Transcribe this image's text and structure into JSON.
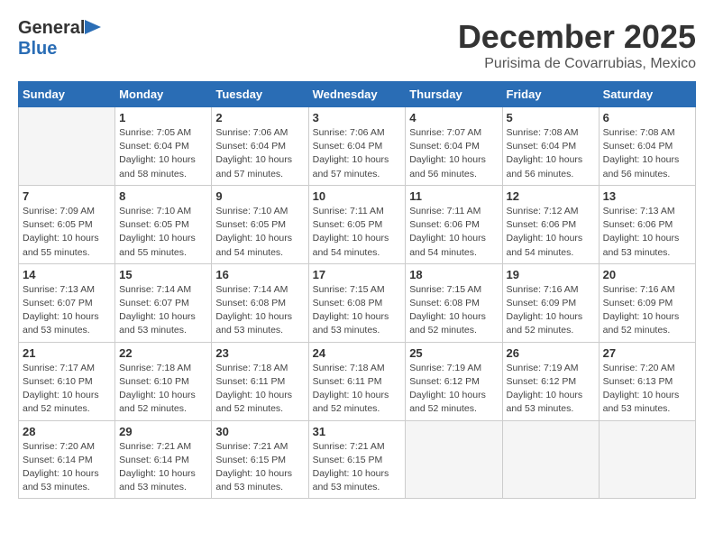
{
  "header": {
    "logo_general": "General",
    "logo_blue": "Blue",
    "month_title": "December 2025",
    "subtitle": "Purisima de Covarrubias, Mexico"
  },
  "days_of_week": [
    "Sunday",
    "Monday",
    "Tuesday",
    "Wednesday",
    "Thursday",
    "Friday",
    "Saturday"
  ],
  "weeks": [
    [
      {
        "day": "",
        "info": ""
      },
      {
        "day": "1",
        "info": "Sunrise: 7:05 AM\nSunset: 6:04 PM\nDaylight: 10 hours\nand 58 minutes."
      },
      {
        "day": "2",
        "info": "Sunrise: 7:06 AM\nSunset: 6:04 PM\nDaylight: 10 hours\nand 57 minutes."
      },
      {
        "day": "3",
        "info": "Sunrise: 7:06 AM\nSunset: 6:04 PM\nDaylight: 10 hours\nand 57 minutes."
      },
      {
        "day": "4",
        "info": "Sunrise: 7:07 AM\nSunset: 6:04 PM\nDaylight: 10 hours\nand 56 minutes."
      },
      {
        "day": "5",
        "info": "Sunrise: 7:08 AM\nSunset: 6:04 PM\nDaylight: 10 hours\nand 56 minutes."
      },
      {
        "day": "6",
        "info": "Sunrise: 7:08 AM\nSunset: 6:04 PM\nDaylight: 10 hours\nand 56 minutes."
      }
    ],
    [
      {
        "day": "7",
        "info": "Sunrise: 7:09 AM\nSunset: 6:05 PM\nDaylight: 10 hours\nand 55 minutes."
      },
      {
        "day": "8",
        "info": "Sunrise: 7:10 AM\nSunset: 6:05 PM\nDaylight: 10 hours\nand 55 minutes."
      },
      {
        "day": "9",
        "info": "Sunrise: 7:10 AM\nSunset: 6:05 PM\nDaylight: 10 hours\nand 54 minutes."
      },
      {
        "day": "10",
        "info": "Sunrise: 7:11 AM\nSunset: 6:05 PM\nDaylight: 10 hours\nand 54 minutes."
      },
      {
        "day": "11",
        "info": "Sunrise: 7:11 AM\nSunset: 6:06 PM\nDaylight: 10 hours\nand 54 minutes."
      },
      {
        "day": "12",
        "info": "Sunrise: 7:12 AM\nSunset: 6:06 PM\nDaylight: 10 hours\nand 54 minutes."
      },
      {
        "day": "13",
        "info": "Sunrise: 7:13 AM\nSunset: 6:06 PM\nDaylight: 10 hours\nand 53 minutes."
      }
    ],
    [
      {
        "day": "14",
        "info": "Sunrise: 7:13 AM\nSunset: 6:07 PM\nDaylight: 10 hours\nand 53 minutes."
      },
      {
        "day": "15",
        "info": "Sunrise: 7:14 AM\nSunset: 6:07 PM\nDaylight: 10 hours\nand 53 minutes."
      },
      {
        "day": "16",
        "info": "Sunrise: 7:14 AM\nSunset: 6:08 PM\nDaylight: 10 hours\nand 53 minutes."
      },
      {
        "day": "17",
        "info": "Sunrise: 7:15 AM\nSunset: 6:08 PM\nDaylight: 10 hours\nand 53 minutes."
      },
      {
        "day": "18",
        "info": "Sunrise: 7:15 AM\nSunset: 6:08 PM\nDaylight: 10 hours\nand 52 minutes."
      },
      {
        "day": "19",
        "info": "Sunrise: 7:16 AM\nSunset: 6:09 PM\nDaylight: 10 hours\nand 52 minutes."
      },
      {
        "day": "20",
        "info": "Sunrise: 7:16 AM\nSunset: 6:09 PM\nDaylight: 10 hours\nand 52 minutes."
      }
    ],
    [
      {
        "day": "21",
        "info": "Sunrise: 7:17 AM\nSunset: 6:10 PM\nDaylight: 10 hours\nand 52 minutes."
      },
      {
        "day": "22",
        "info": "Sunrise: 7:18 AM\nSunset: 6:10 PM\nDaylight: 10 hours\nand 52 minutes."
      },
      {
        "day": "23",
        "info": "Sunrise: 7:18 AM\nSunset: 6:11 PM\nDaylight: 10 hours\nand 52 minutes."
      },
      {
        "day": "24",
        "info": "Sunrise: 7:18 AM\nSunset: 6:11 PM\nDaylight: 10 hours\nand 52 minutes."
      },
      {
        "day": "25",
        "info": "Sunrise: 7:19 AM\nSunset: 6:12 PM\nDaylight: 10 hours\nand 52 minutes."
      },
      {
        "day": "26",
        "info": "Sunrise: 7:19 AM\nSunset: 6:12 PM\nDaylight: 10 hours\nand 53 minutes."
      },
      {
        "day": "27",
        "info": "Sunrise: 7:20 AM\nSunset: 6:13 PM\nDaylight: 10 hours\nand 53 minutes."
      }
    ],
    [
      {
        "day": "28",
        "info": "Sunrise: 7:20 AM\nSunset: 6:14 PM\nDaylight: 10 hours\nand 53 minutes."
      },
      {
        "day": "29",
        "info": "Sunrise: 7:21 AM\nSunset: 6:14 PM\nDaylight: 10 hours\nand 53 minutes."
      },
      {
        "day": "30",
        "info": "Sunrise: 7:21 AM\nSunset: 6:15 PM\nDaylight: 10 hours\nand 53 minutes."
      },
      {
        "day": "31",
        "info": "Sunrise: 7:21 AM\nSunset: 6:15 PM\nDaylight: 10 hours\nand 53 minutes."
      },
      {
        "day": "",
        "info": ""
      },
      {
        "day": "",
        "info": ""
      },
      {
        "day": "",
        "info": ""
      }
    ]
  ]
}
